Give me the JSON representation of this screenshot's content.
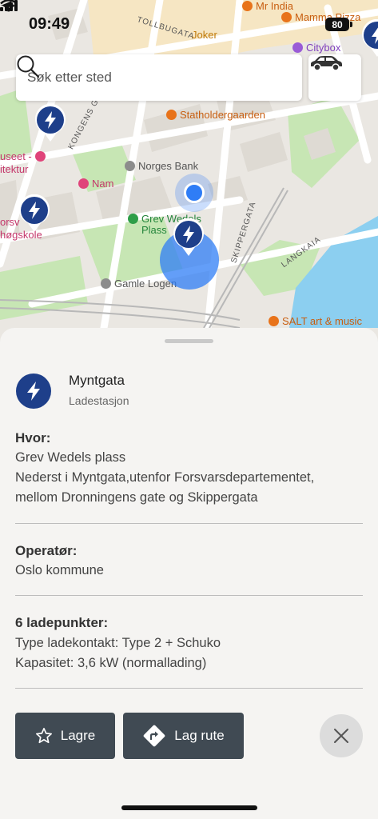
{
  "status_bar": {
    "time": "09:49",
    "battery": "80"
  },
  "search": {
    "placeholder": "Søk etter sted"
  },
  "map": {
    "streets": [
      "TOLLBUGATA",
      "KONGENS G",
      "SKIPPERGATA",
      "LANGKAIA"
    ],
    "places": [
      {
        "key": "mr_india",
        "label": "Mr India",
        "color": "#e8731a"
      },
      {
        "key": "mamma_pizza",
        "label": "Mamma Pizza",
        "color": "#e8731a"
      },
      {
        "key": "joker",
        "label": "Joker",
        "color": "#e8a317"
      },
      {
        "key": "citybox",
        "label": "Citybox",
        "color": "#9a5bd6"
      },
      {
        "key": "statholdergaarden",
        "label": "Statholdergaarden",
        "color": "#e8731a"
      },
      {
        "key": "norges_bank",
        "label": "Norges Bank",
        "color": "#8c8c8c"
      },
      {
        "key": "museet",
        "label": "useet -",
        "color": "#e0447a"
      },
      {
        "key": "arkitektur",
        "label": "itektur",
        "color": "#e0447a"
      },
      {
        "key": "nam",
        "label": "Nam",
        "color": "#e0447a"
      },
      {
        "key": "grev_wedels_1",
        "label": "Grev Wedels",
        "color": "#2e9e48"
      },
      {
        "key": "grev_wedels_2",
        "label": "Plass",
        "color": "#2e9e48"
      },
      {
        "key": "forsvars",
        "label": "orsv",
        "color": "#e0447a"
      },
      {
        "key": "hogskole",
        "label": "høgskole",
        "color": "#e0447a"
      },
      {
        "key": "gamle_logen",
        "label": "Gamle Logen",
        "color": "#8c8c8c"
      },
      {
        "key": "salt",
        "label": "SALT art & music",
        "color": "#e8731a"
      }
    ]
  },
  "station": {
    "name": "Myntgata",
    "type": "Ladestasjon",
    "where_title": "Hvor:",
    "where_lines": [
      "Grev Wedels plass",
      "Nederst i Myntgata,utenfor Forsvarsdepartementet,",
      "mellom Dronningens gate og Skippergata"
    ],
    "operator_title": "Operatør:",
    "operator": "Oslo kommune",
    "points_title": "6 ladepunkter:",
    "points_lines": [
      "Type ladekontakt: Type 2 + Schuko",
      "Kapasitet: 3,6 kW (normallading)"
    ]
  },
  "actions": {
    "save_label": "Lagre",
    "route_label": "Lag rute"
  },
  "colors": {
    "marker": "#1e3f8a",
    "button": "#404a53",
    "water": "#8ccff0",
    "park": "#c7e6b4",
    "user": "#2f7df6"
  }
}
